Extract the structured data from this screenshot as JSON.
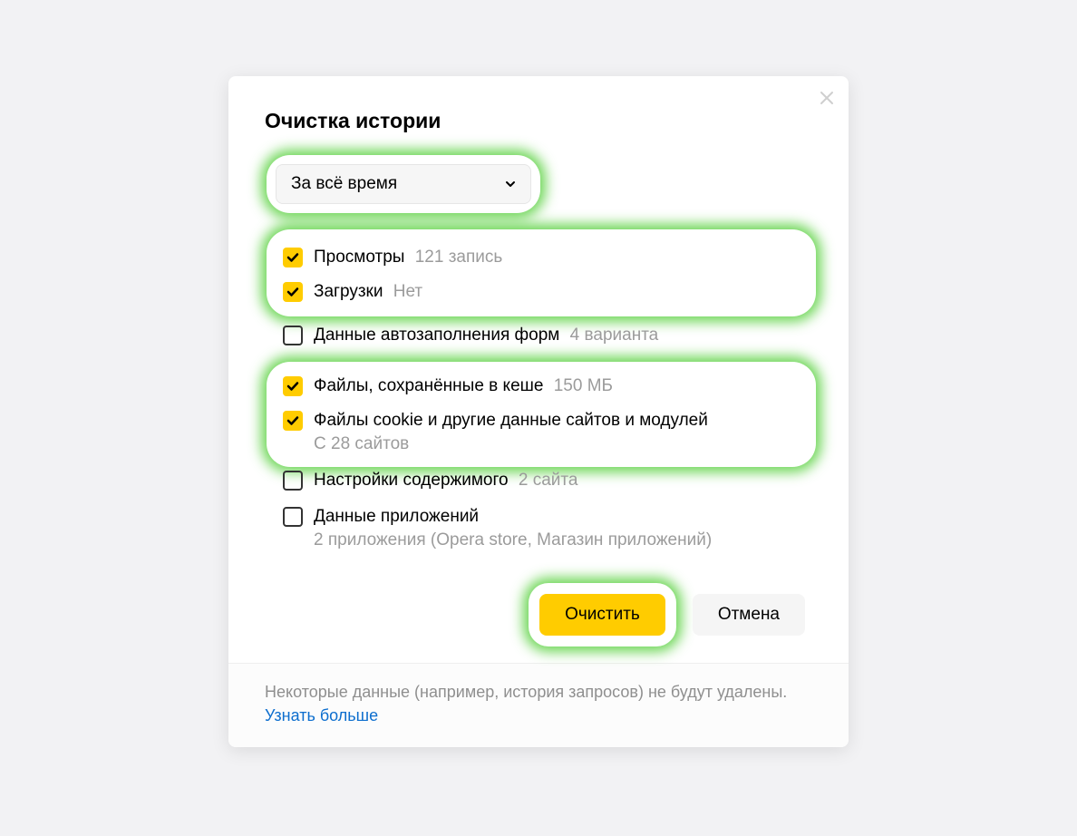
{
  "dialog": {
    "title": "Очистка истории",
    "time_range": "За всё время",
    "options": {
      "views": {
        "label": "Просмотры",
        "meta": "121 запись"
      },
      "downloads": {
        "label": "Загрузки",
        "meta": "Нет"
      },
      "autofill": {
        "label": "Данные автозаполнения форм",
        "meta": "4 варианта"
      },
      "cache": {
        "label": "Файлы, сохранённые в кеше",
        "meta": "150 МБ"
      },
      "cookies": {
        "label": "Файлы cookie и другие данные сайтов и модулей",
        "sub": "С 28 сайтов"
      },
      "content_settings": {
        "label": "Настройки содержимого",
        "meta": "2 сайта"
      },
      "app_data": {
        "label": "Данные приложений",
        "sub": "2 приложения (Opera store, Магазин приложений)"
      }
    },
    "buttons": {
      "clear": "Очистить",
      "cancel": "Отмена"
    },
    "footer": {
      "text": "Некоторые данные (например, история запросов) не будут удалены.",
      "link": "Узнать больше"
    }
  }
}
